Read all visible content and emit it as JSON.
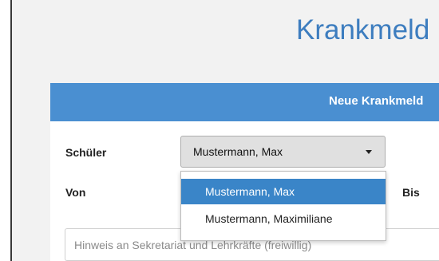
{
  "page": {
    "title": "Krankmeld"
  },
  "card": {
    "header_title": "Neue Krankmeld"
  },
  "form": {
    "schueler_label": "Schüler",
    "von_label": "Von",
    "bis_label": "Bis",
    "schueler_select": {
      "selected": "Mustermann, Max",
      "options": [
        "Mustermann, Max",
        "Mustermann, Maximiliane"
      ]
    },
    "hint_placeholder": "Hinweis an Sekretariat und Lehrkräfte (freiwillig)"
  },
  "icons": {
    "select_caret": "caret-down-icon"
  },
  "colors": {
    "accent": "#4a8fd1",
    "title": "#3d7dbf",
    "option_selected": "#3a85c8"
  }
}
